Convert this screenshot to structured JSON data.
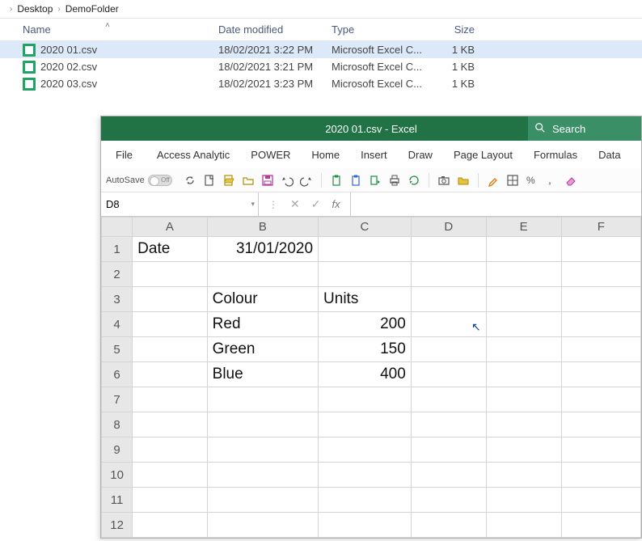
{
  "breadcrumb": {
    "a": "Desktop",
    "b": "DemoFolder"
  },
  "explorer_cols": {
    "name": "Name",
    "date": "Date modified",
    "type": "Type",
    "size": "Size"
  },
  "files": [
    {
      "name": "2020 01.csv",
      "date": "18/02/2021 3:22 PM",
      "type": "Microsoft Excel C...",
      "size": "1 KB",
      "selected": true
    },
    {
      "name": "2020 02.csv",
      "date": "18/02/2021 3:21 PM",
      "type": "Microsoft Excel C...",
      "size": "1 KB",
      "selected": false
    },
    {
      "name": "2020 03.csv",
      "date": "18/02/2021 3:23 PM",
      "type": "Microsoft Excel C...",
      "size": "1 KB",
      "selected": false
    }
  ],
  "excel": {
    "title": "2020 01.csv - Excel",
    "search_placeholder": "Search",
    "autosave": "AutoSave",
    "autosave_state": "Off",
    "tabs": [
      "File",
      "Access Analytic",
      "POWER",
      "Home",
      "Insert",
      "Draw",
      "Page Layout",
      "Formulas",
      "Data"
    ],
    "namebox": "D8",
    "fx_label": "fx",
    "columns": [
      "A",
      "B",
      "C",
      "D",
      "E",
      "F"
    ],
    "rows": [
      "1",
      "2",
      "3",
      "4",
      "5",
      "6",
      "7",
      "8",
      "9",
      "10",
      "11",
      "12"
    ],
    "cells": {
      "A1": "Date",
      "B1": "31/01/2020",
      "B3": "Colour",
      "C3": "Units",
      "B4": "Red",
      "C4": "200",
      "B5": "Green",
      "C5": "150",
      "B6": "Blue",
      "C6": "400"
    }
  }
}
